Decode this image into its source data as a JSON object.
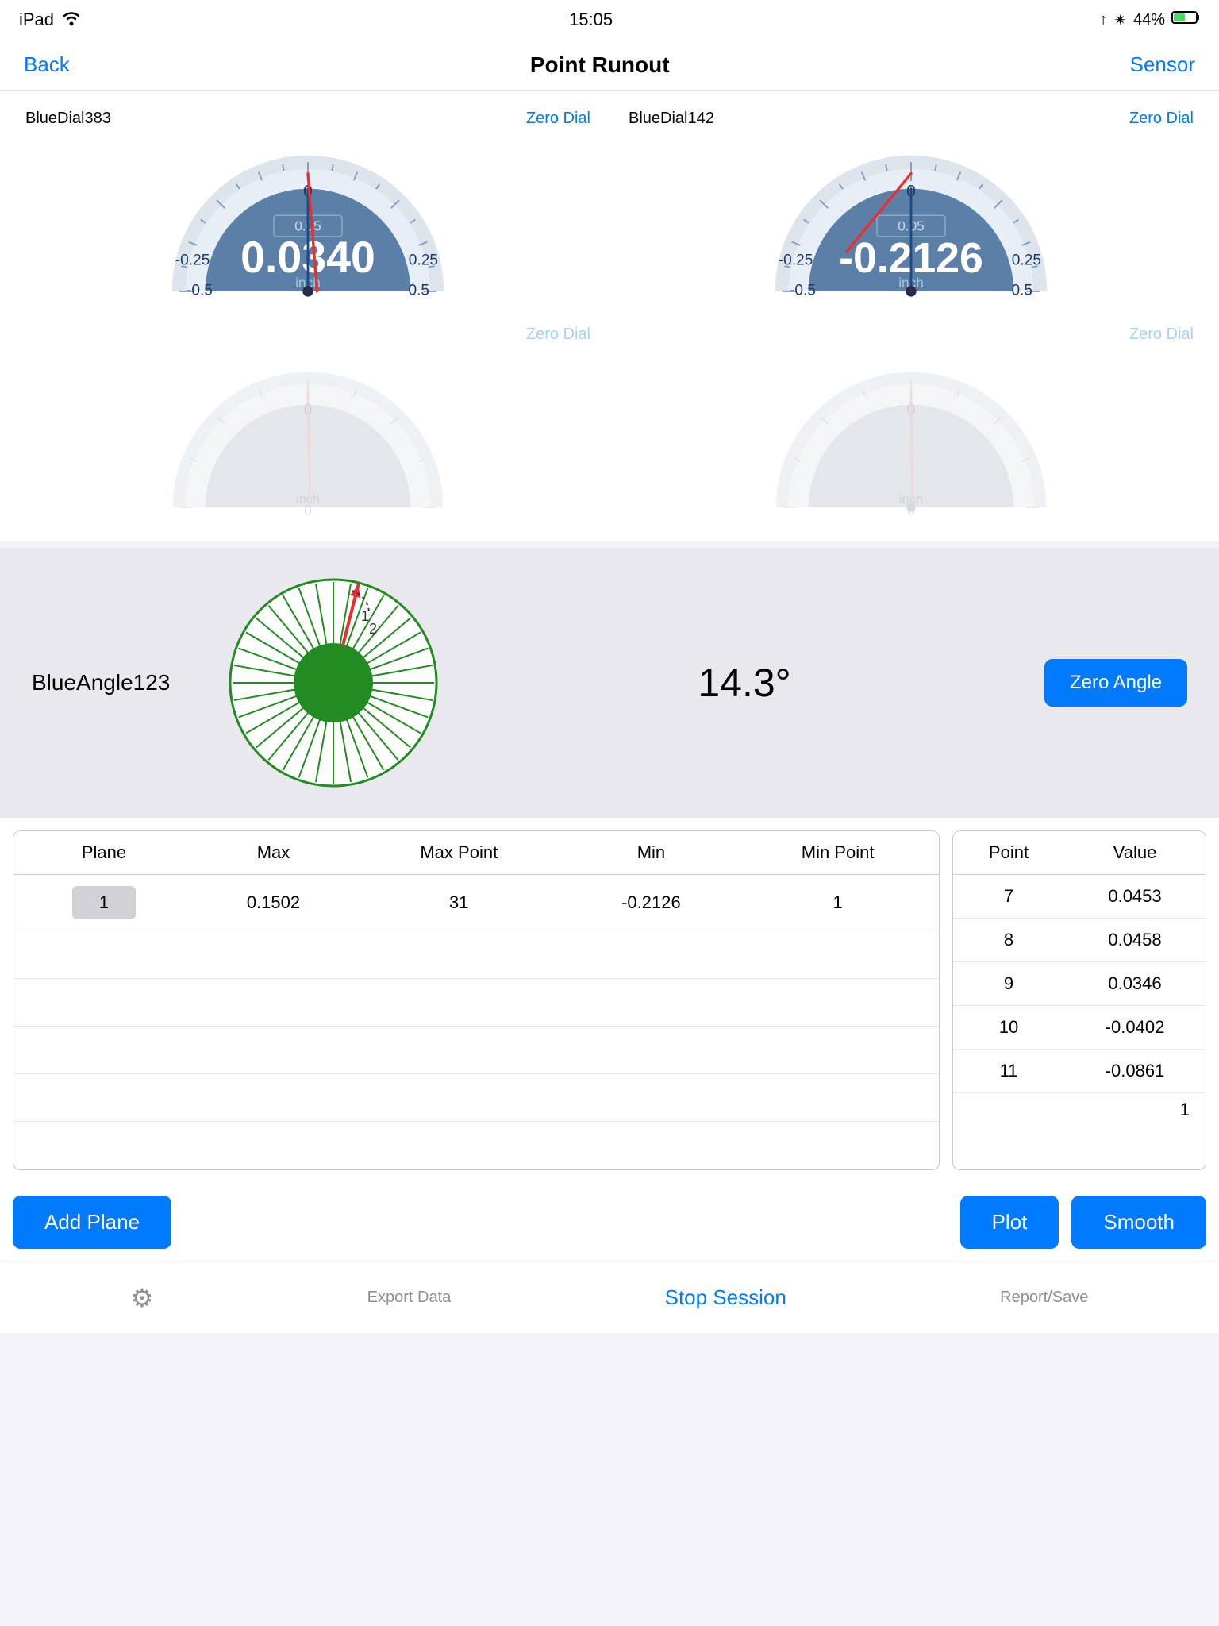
{
  "statusBar": {
    "carrier": "iPad",
    "wifi": "wifi",
    "time": "15:05",
    "gps": "↑",
    "bluetooth": "✴",
    "battery": "44%"
  },
  "navBar": {
    "back": "Back",
    "title": "Point Runout",
    "action": "Sensor"
  },
  "dial1": {
    "name": "BlueDial383",
    "zeroDial": "Zero Dial",
    "value": "0.0340",
    "unit": "inch",
    "scaleMin": "-0.5",
    "scaleMid1": "-0.25",
    "scaleMid2": "0",
    "scaleMid3": "0.25",
    "scaleMax": "0.5",
    "subMin": "0.05"
  },
  "dial2": {
    "name": "BlueDial142",
    "zeroDial": "Zero Dial",
    "value": "-0.2126",
    "unit": "inch",
    "scaleMin": "-0.5",
    "scaleMid1": "-0.25",
    "scaleMid2": "0",
    "scaleMid3": "0.25",
    "scaleMax": "0.5",
    "subMin": "0.05"
  },
  "dial3": {
    "zeroDial": "Zero Dial",
    "unit": "inch",
    "scaleVal": "0"
  },
  "dial4": {
    "zeroDial": "Zero Dial",
    "unit": "inch",
    "scaleVal": "0"
  },
  "angleSection": {
    "label": "BlueAngle123",
    "value": "14.3°",
    "zeroAngle": "Zero Angle"
  },
  "planeTable": {
    "headers": [
      "Plane",
      "Max",
      "Max Point",
      "Min",
      "Min Point"
    ],
    "rows": [
      {
        "plane": "1",
        "max": "0.1502",
        "maxPoint": "31",
        "min": "-0.2126",
        "minPoint": "1"
      }
    ]
  },
  "pointTable": {
    "headers": [
      "Point",
      "Value"
    ],
    "rows": [
      {
        "point": "7",
        "value": "0.0453"
      },
      {
        "point": "8",
        "value": "0.0458"
      },
      {
        "point": "9",
        "value": "0.0346"
      },
      {
        "point": "10",
        "value": "-0.0402"
      },
      {
        "point": "11",
        "value": "-0.0861"
      }
    ],
    "pageNumber": "1"
  },
  "actionButtons": {
    "addPlane": "Add Plane",
    "plot": "Plot",
    "smooth": "Smooth"
  },
  "toolbar": {
    "settings": "⚙",
    "exportData": "Export Data",
    "stopSession": "Stop Session",
    "reportSave": "Report/Save"
  }
}
